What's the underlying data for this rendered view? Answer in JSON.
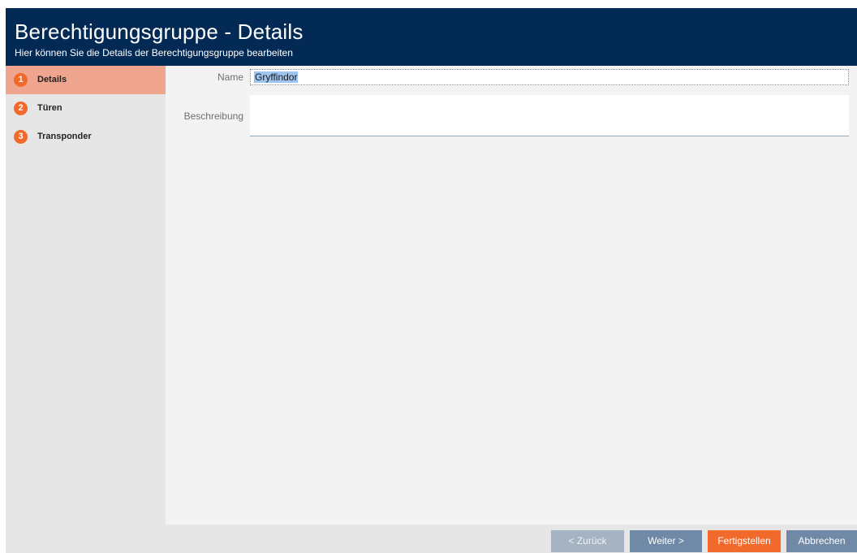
{
  "header": {
    "title": "Berechtigungsgruppe - Details",
    "subtitle": "Hier können Sie die Details der Berechtigungsgruppe bearbeiten"
  },
  "steps": [
    {
      "number": "1",
      "label": "Details",
      "active": true
    },
    {
      "number": "2",
      "label": "Türen",
      "active": false
    },
    {
      "number": "3",
      "label": "Transponder",
      "active": false
    }
  ],
  "form": {
    "name_label": "Name",
    "name_value": "Gryffindor",
    "description_label": "Beschreibung",
    "description_value": ""
  },
  "footer": {
    "back_label": "< Zurück",
    "next_label": "Weiter >",
    "finish_label": "Fertigstellen",
    "cancel_label": "Abbrechen"
  },
  "colors": {
    "header_bg": "#032a55",
    "accent": "#f26a2b",
    "active_step_bg": "#f0a58e",
    "button_blue": "#6f89a6",
    "button_disabled": "#a6b3c2"
  }
}
